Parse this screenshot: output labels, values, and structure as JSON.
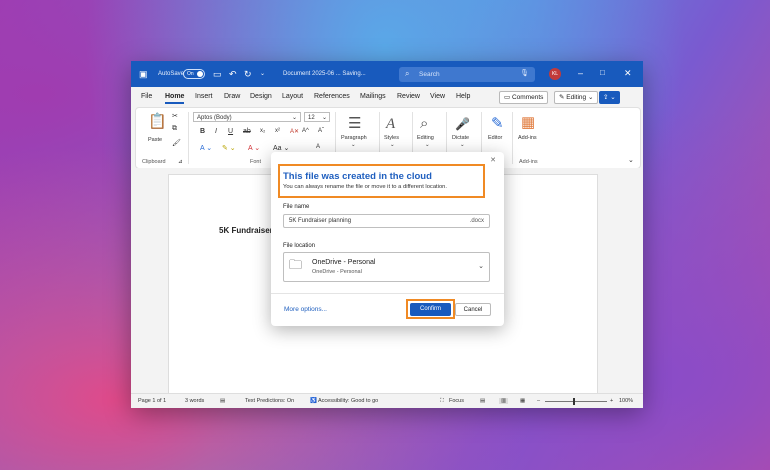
{
  "titlebar": {
    "autosave_label": "AutoSave",
    "autosave_state": "On",
    "doc_title": "Document 2025-06 ... Saving...",
    "search_placeholder": "Search",
    "user_initials": "KL"
  },
  "menu": [
    "File",
    "Home",
    "Insert",
    "Draw",
    "Design",
    "Layout",
    "References",
    "Mailings",
    "Review",
    "View",
    "Help"
  ],
  "menu_right": {
    "comments": "Comments",
    "editing": "Editing"
  },
  "ribbon": {
    "paste": "Paste",
    "clipboard": "Clipboard",
    "font_name": "Aptos (Body)",
    "font_size": "12",
    "font_group": "Font",
    "paragraph": "Paragraph",
    "styles": "Styles",
    "editing": "Editing",
    "dictate": "Dictate",
    "editor": "Editor",
    "addins": "Add-ins",
    "addins_group": "Add-ins"
  },
  "document": {
    "heading": "5K Fundraiser"
  },
  "status": {
    "page": "Page 1 of 1",
    "words": "3 words",
    "predictions": "Text Predictions: On",
    "accessibility": "Accessibility: Good to go",
    "focus": "Focus",
    "zoom": "100%"
  },
  "dialog": {
    "title": "This file was created in the cloud",
    "subtitle": "You can always rename the file or move it to a different location.",
    "file_name_label": "File name",
    "file_name_value": "5K Fundraiser planning",
    "file_ext": ".docx",
    "location_label": "File location",
    "location_name": "OneDrive - Personal",
    "location_sub": "OneDrive - Personal",
    "more_options": "More options...",
    "confirm": "Confirm",
    "cancel": "Cancel"
  },
  "colors": {
    "accent": "#185abd",
    "highlight": "#f08a24",
    "link": "#1f5fbf"
  }
}
